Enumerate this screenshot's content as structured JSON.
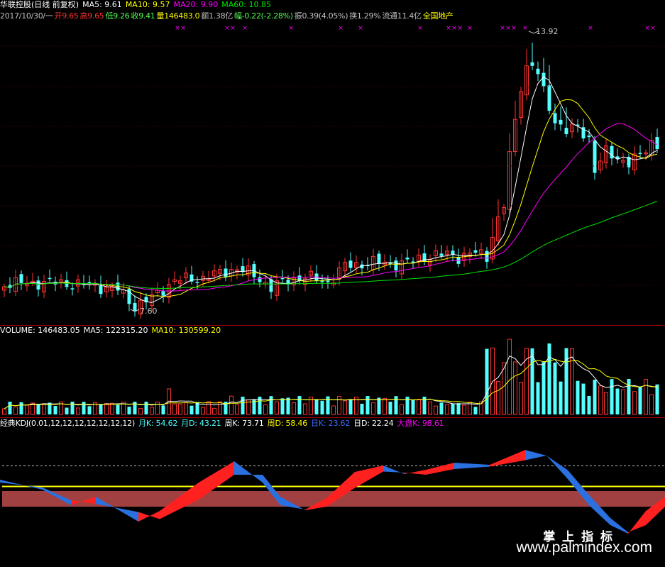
{
  "header": {
    "title": "华联控股(日线 前复权)",
    "ma5": "MA5: 9.61",
    "ma10": "MA10: 9.57",
    "ma20": "MA20: 9.90",
    "ma60": "MA60: 10.85"
  },
  "quote": {
    "date": "2017/10/30/一",
    "open": "开9.65",
    "high": "高9.65",
    "low": "低9.26",
    "close": "收9.41",
    "volume": "量146483.0",
    "amount": "额1.38亿",
    "change": "幅-0.22(-2.28%)",
    "amplitude": "振0.39(4.05%)",
    "turnover": "换1.29%",
    "float_cap": "流通11.4亿",
    "sector": "全国地产"
  },
  "price_labels": {
    "high": "13.92",
    "low": "7.60"
  },
  "volume_panel": {
    "label": "VOLUME: 146483.05",
    "ma5": "MA5: 122315.20",
    "ma10": "MA10: 130599.20"
  },
  "kdj_panel": {
    "label": "经典KDJ(0.01,12,12,12,12,12,12,12)",
    "month_k": "月K: 54.62",
    "month_d": "月D: 43.21",
    "week_k": "周K: 73.71",
    "week_d": "周D: 58.46",
    "day_k": "日K: 23.62",
    "day_d": "日D: 22.24",
    "market_k": "大盘K: 98.61"
  },
  "watermark": {
    "brand": "掌 上 指 标",
    "url": "www.palmindex.com"
  },
  "colors": {
    "up": "#ff3232",
    "down": "#54ffff",
    "ma5": "#ffffff",
    "ma10": "#ffff00",
    "ma20": "#ff00ff",
    "ma60": "#00e600",
    "panel_border": "#a00000"
  }
}
